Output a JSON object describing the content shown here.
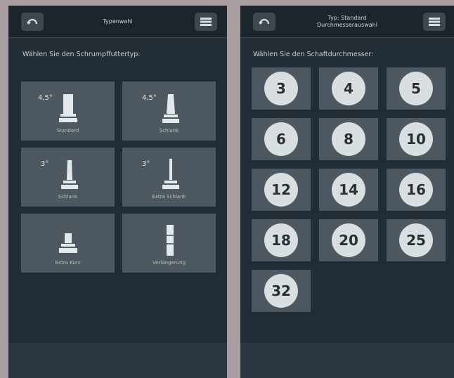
{
  "left_screen": {
    "header_title": "Typenwahl",
    "subtitle": "Wählen Sie den Schrumpffuttertyp:",
    "tiles": [
      {
        "label": "Standard",
        "size": "4,5°",
        "icon": "standard-chuck-icon"
      },
      {
        "label": "Schlank",
        "size": "4,5°",
        "icon": "slim-chuck-icon"
      },
      {
        "label": "Schlank",
        "size": "3°",
        "icon": "slim-3deg-chuck-icon"
      },
      {
        "label": "Extra Schlank",
        "size": "3°",
        "icon": "extra-slim-chuck-icon"
      },
      {
        "label": "Extra Kurz",
        "size": "",
        "icon": "extra-short-chuck-icon"
      },
      {
        "label": "Verlängerung",
        "size": "",
        "icon": "extension-icon"
      }
    ]
  },
  "right_screen": {
    "header_title_line1": "Typ: Standard",
    "header_title_line2": "Durchmesserauswahl",
    "subtitle": "Wählen Sie den Schaftdurchmesser:",
    "diameters": [
      "3",
      "4",
      "5",
      "6",
      "8",
      "10",
      "12",
      "14",
      "16",
      "18",
      "20",
      "25",
      "32"
    ]
  },
  "icons": {
    "back": "back-arrow-icon",
    "menu": "menu-icon"
  },
  "colors": {
    "screen_bg": "#222c35",
    "tile_bg": "#4d5860",
    "circle_bg": "#d9dee1",
    "outer_bg": "#a89da1"
  }
}
